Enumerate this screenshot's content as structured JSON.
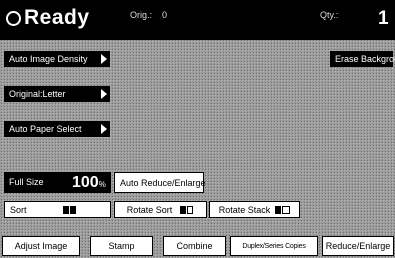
{
  "status": {
    "ready": "Ready",
    "orig_label": "Orig.:",
    "orig_value": "0",
    "qty_label": "Qty.:",
    "qty_value": "1"
  },
  "modes": {
    "auto_image_density": "Auto Image Density",
    "original_letter": "Original:Letter",
    "auto_paper_select": "Auto Paper Select",
    "erase_background": "Erase Background"
  },
  "zoom": {
    "label": "Full Size",
    "value": "100",
    "unit": "%",
    "auto_reduce_enlarge": "Auto Reduce/Enlarge"
  },
  "finishing": {
    "sort": "Sort",
    "rotate_sort": "Rotate Sort",
    "rotate_stack": "Rotate Stack"
  },
  "tabs": [
    "Adjust Image",
    "Stamp",
    "Combine",
    "Duplex/Series Copies",
    "Reduce/Enlarge"
  ],
  "colors": {
    "panel": "#9c9c9c",
    "header": "#000000",
    "button": "#ffffff"
  }
}
